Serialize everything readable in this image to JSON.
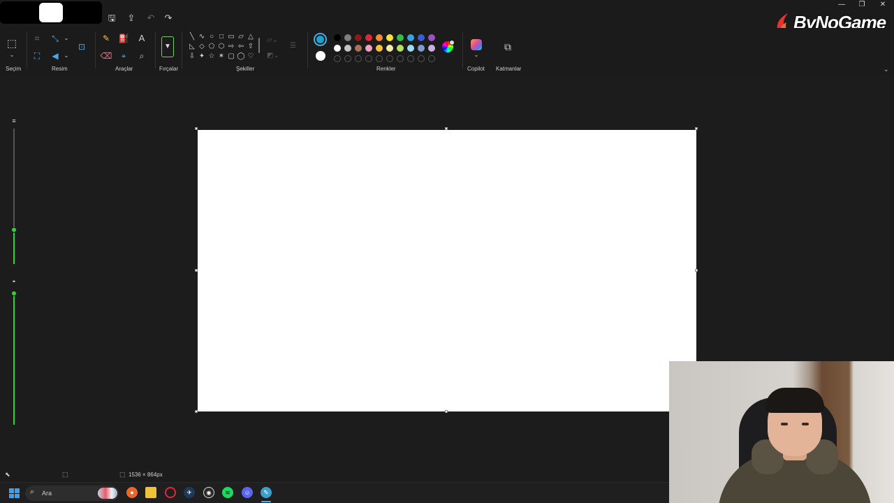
{
  "window": {
    "brand_text": "ByNoGame",
    "controls": {
      "minimize": "—",
      "restore": "❐",
      "close": "✕"
    }
  },
  "titlebar_icons": [
    "save-icon",
    "share-icon",
    "undo-icon",
    "redo-icon"
  ],
  "ribbon": {
    "groups": {
      "selection": "Seçim",
      "image": "Resim",
      "tools": "Araçlar",
      "brushes": "Fırçalar",
      "shapes": "Şekiller",
      "colors": "Renkler",
      "copilot": "Copilot",
      "layers": "Katmanlar"
    },
    "shape_glyphs": [
      "╲",
      "∿",
      "○",
      "□",
      "▭",
      "▱",
      "△",
      "◺",
      "◇",
      "⬠",
      "⬡",
      "⇨",
      "⇦",
      "⇧",
      "⇩",
      "✦",
      "☆",
      "✶",
      "▢",
      "◯",
      "♡"
    ]
  },
  "colors": {
    "primary": "#1aa3cf",
    "secondary": "#ffffff",
    "palette_row1": [
      "#000000",
      "#7f7f7f",
      "#8b1a1a",
      "#e0283a",
      "#f28b30",
      "#f5e435",
      "#2cc04b",
      "#35a3e0",
      "#3b5ad6",
      "#9b4fc4"
    ],
    "palette_row2": [
      "#ffffff",
      "#c3c3c3",
      "#a5735a",
      "#f2a2c0",
      "#f5c33b",
      "#f0eba7",
      "#b5e061",
      "#9bdcf0",
      "#7f9bd0",
      "#c7b2e0"
    ],
    "palette_row3_empty": 10,
    "slider_accent": "#2fd23a"
  },
  "sliders": {
    "size_level": 0.25,
    "opacity_level": 1.0
  },
  "status": {
    "canvas_size": "1536 × 864px"
  },
  "taskbar": {
    "search_placeholder": "Ara",
    "apps": [
      "firefox-icon",
      "folder-icon",
      "opera-icon",
      "steam-icon",
      "chatgpt-icon",
      "spotify-icon",
      "discord-icon",
      "paint-icon"
    ]
  }
}
